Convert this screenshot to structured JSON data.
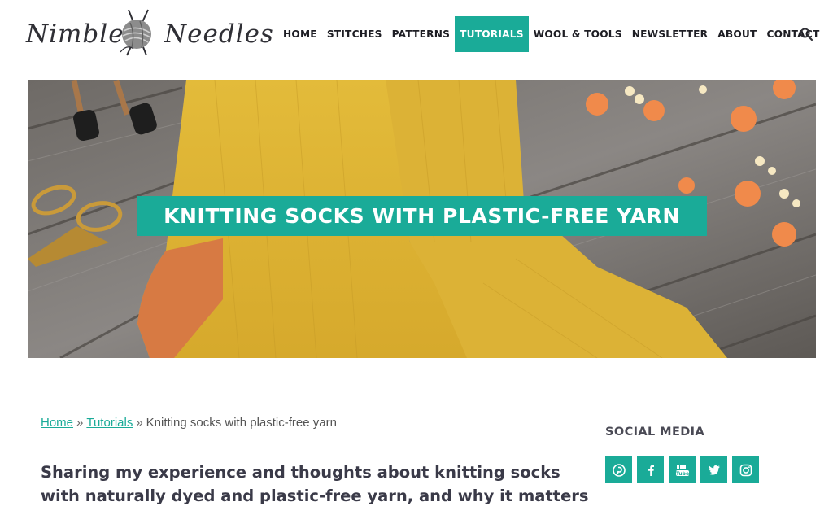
{
  "brand": {
    "logo_left": "Nimble",
    "logo_right": "Needles",
    "accent_color": "#1aab98"
  },
  "nav": {
    "items": [
      {
        "label": "HOME",
        "active": false
      },
      {
        "label": "STITCHES",
        "active": false
      },
      {
        "label": "PATTERNS",
        "active": false
      },
      {
        "label": "TUTORIALS",
        "active": true
      },
      {
        "label": "WOOL & TOOLS",
        "active": false
      },
      {
        "label": "NEWSLETTER",
        "active": false
      },
      {
        "label": "ABOUT",
        "active": false
      },
      {
        "label": "CONTACT",
        "active": false
      }
    ],
    "search_icon": "search-icon"
  },
  "hero": {
    "title": "KNITTING SOCKS WITH PLASTIC-FREE YARN"
  },
  "breadcrumb": {
    "home": "Home",
    "separator": "»",
    "section": "Tutorials",
    "current": "Knitting socks with plastic-free yarn"
  },
  "article": {
    "lead": "Sharing my experience and thoughts about knitting socks with naturally dyed and plastic-free yarn, and why it matters"
  },
  "sidebar": {
    "social_title": "SOCIAL MEDIA",
    "social_icons": [
      "pinterest-icon",
      "facebook-icon",
      "youtube-icon",
      "twitter-icon",
      "instagram-icon"
    ]
  }
}
